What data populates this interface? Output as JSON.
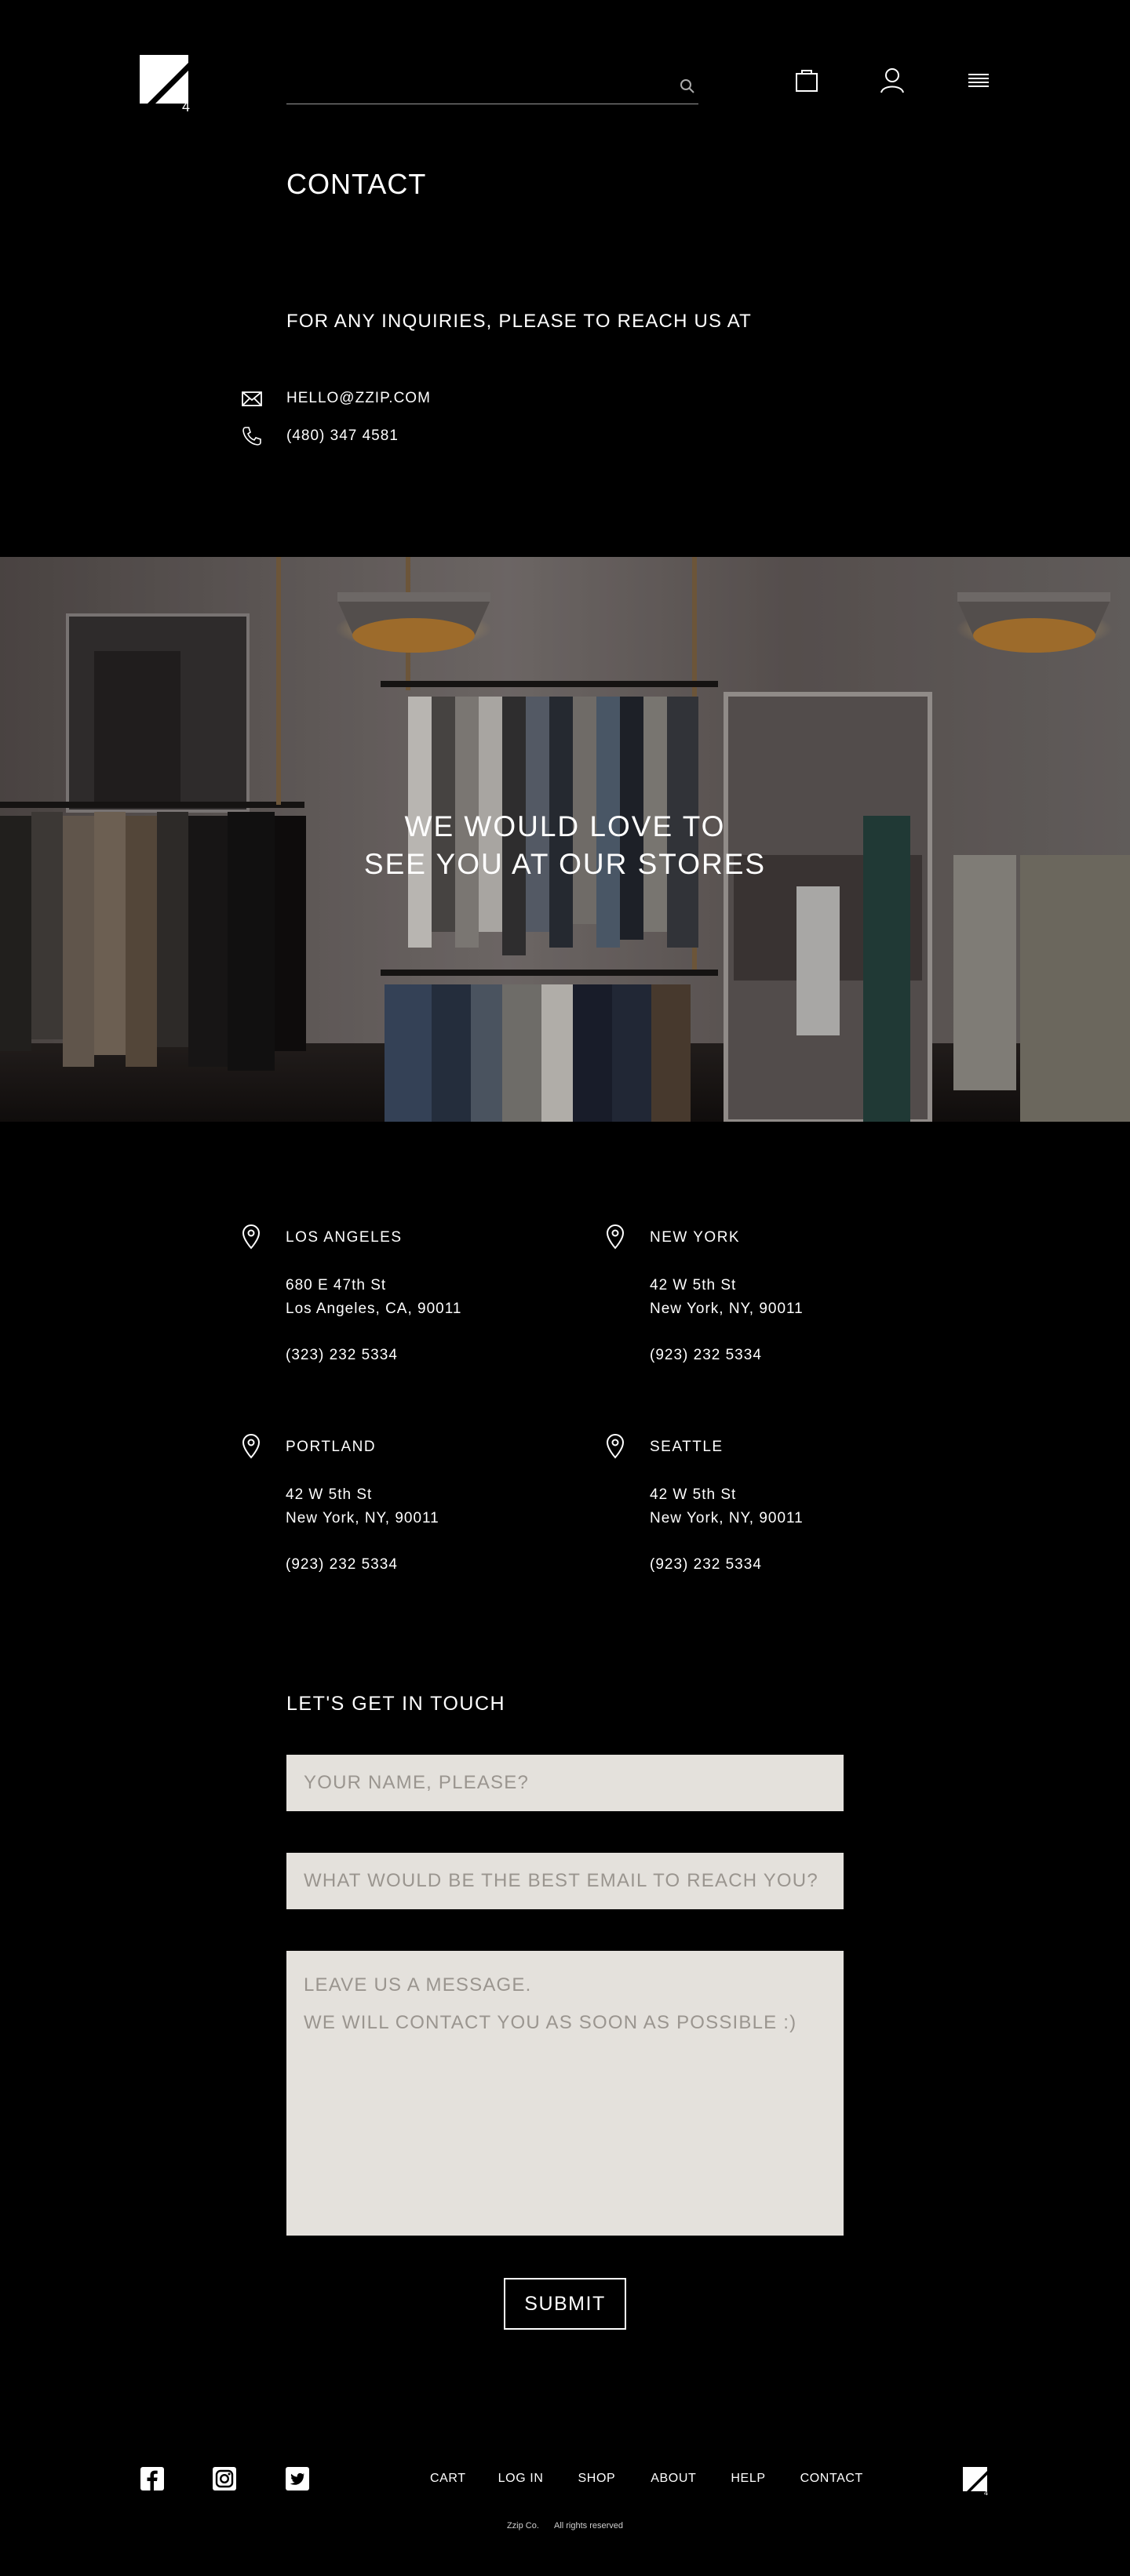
{
  "header": {
    "logo_alt": "Zzip logo",
    "search": {
      "value": "",
      "placeholder": ""
    },
    "icons": [
      "search-icon",
      "bag-icon",
      "user-icon",
      "menu-icon"
    ]
  },
  "contact": {
    "title": "CONTACT",
    "inquiry": "FOR ANY INQUIRIES, PLEASE TO REACH US AT",
    "email": "HELLO@ZZIP.COM",
    "phone": "(480) 347 4581"
  },
  "hero": {
    "line1": "WE WOULD LOVE TO",
    "line2": "SEE YOU AT OUR STORES"
  },
  "stores": [
    {
      "name": "LOS ANGELES",
      "addr1": "680 E 47th St",
      "addr2": "Los Angeles, CA, 90011",
      "phone": "(323) 232 5334"
    },
    {
      "name": "NEW YORK",
      "addr1": "42 W 5th St",
      "addr2": "New York, NY, 90011",
      "phone": "(923) 232 5334"
    },
    {
      "name": "PORTLAND",
      "addr1": "42 W 5th St",
      "addr2": "New York, NY, 90011",
      "phone": "(923) 232 5334"
    },
    {
      "name": "SEATTLE",
      "addr1": "42 W 5th St",
      "addr2": "New York, NY, 90011",
      "phone": "(923) 232 5334"
    }
  ],
  "form": {
    "title": "LET'S GET IN TOUCH",
    "name_placeholder": "YOUR NAME, PLEASE?",
    "email_placeholder": "WHAT WOULD BE THE BEST EMAIL TO REACH YOU?",
    "message_placeholder": "LEAVE US A MESSAGE.\nWE WILL CONTACT YOU AS SOON AS POSSIBLE :)",
    "submit_label": "SUBMIT"
  },
  "footer": {
    "social": [
      "facebook-icon",
      "instagram-icon",
      "twitter-icon"
    ],
    "nav": [
      "CART",
      "LOG IN",
      "SHOP",
      "ABOUT",
      "HELP",
      "CONTACT"
    ],
    "company": "Zzip Co.",
    "rights": "All rights reserved"
  },
  "colors": {
    "background": "#000000",
    "text": "#ffffff",
    "field_bg": "#e4e1dc",
    "placeholder": "#9a958f"
  }
}
